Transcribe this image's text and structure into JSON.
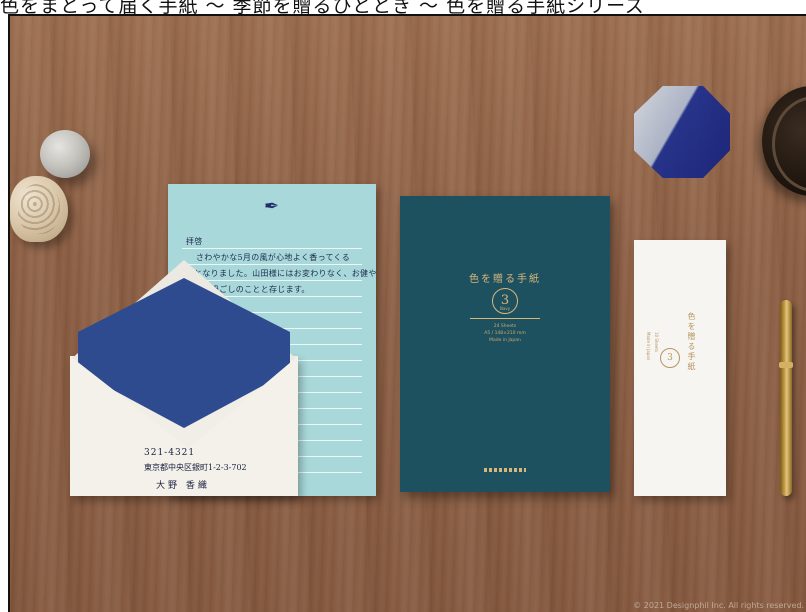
{
  "caption": "色をまとって届く手紙 〜 季節を贈るひととき 〜 色を贈る手紙シリーズ",
  "letter": {
    "greeting": "拝啓",
    "lines": [
      "さわやかな5月の風が心地よく香ってくる",
      "頃となりました。山田様にはお変わりなく、お健や",
      "かにお過ごしのことと存じます。"
    ]
  },
  "envelope": {
    "postal_code": "321-4321",
    "address": "東京都中央区銀町1-2-3-702",
    "name": "大野 香織"
  },
  "notebook": {
    "title": "色を贈る手紙",
    "number": "3",
    "number_sub": "Navy",
    "spec_lines": [
      "24 Sheets",
      "A5 / 148×210 mm",
      "Made in Japan"
    ]
  },
  "card": {
    "title": "色を贈る手紙",
    "number": "3",
    "spec_lines": [
      "10 Sheets",
      "Made in Japan"
    ]
  },
  "watermark": "© 2021 Designphil Inc. All rights reserved."
}
